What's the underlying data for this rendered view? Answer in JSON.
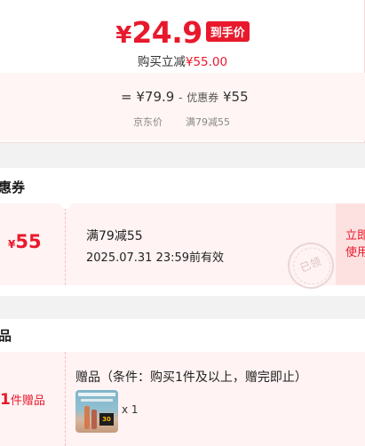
{
  "price_card": {
    "currency": "¥",
    "final_price": "24.9",
    "final_tag": "到手价",
    "save_prefix": "购买立减",
    "save_amount": "¥55.00",
    "calc_equals": "=",
    "original_price": "¥79.9",
    "minus": "-",
    "coupon_label": "优惠券",
    "coupon_value": "¥55",
    "original_caption": "京东价",
    "coupon_caption": "满79减55"
  },
  "coupons": {
    "title": "惠券",
    "item": {
      "currency": "¥",
      "amount": "55",
      "name": "满79减55",
      "valid_until": "2025.07.31 23:59前有效",
      "stamp": "已领",
      "claim_line1": "立即",
      "claim_line2": "使用"
    }
  },
  "gifts": {
    "title": "品",
    "count": "1",
    "count_suffix": "件赠品",
    "rule": "赠品（条件：购买1件及以上，赠完即止）",
    "thumb_badge": "30",
    "quantity": "x 1"
  },
  "colors": {
    "accent": "#e8192c",
    "coupon_bg": "#fff3f3",
    "claim_bg": "#fde1e1"
  }
}
